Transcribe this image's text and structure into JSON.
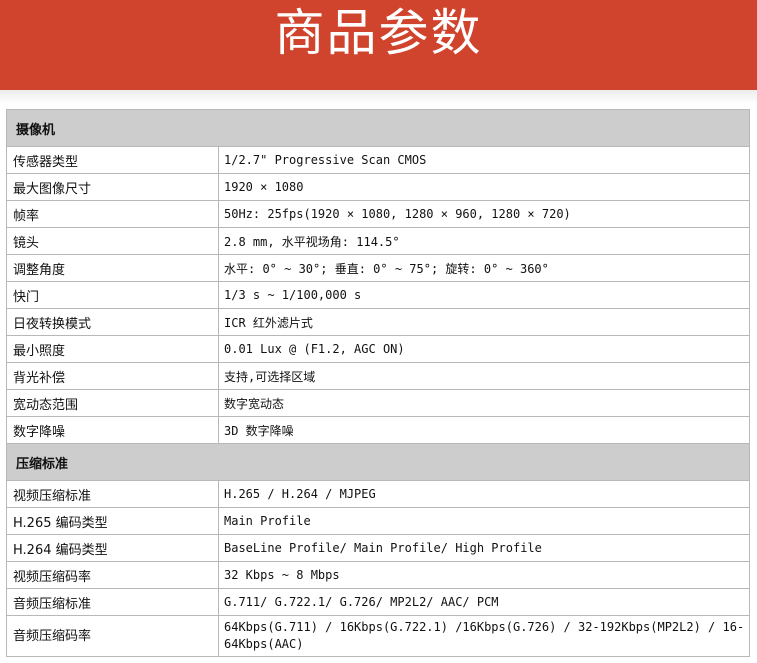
{
  "banner": {
    "title": "商品参数"
  },
  "sections": [
    {
      "title": "摄像机",
      "rows": [
        {
          "label": "传感器类型",
          "value": "1/2.7\" Progressive Scan CMOS"
        },
        {
          "label": "最大图像尺寸",
          "value": "1920 × 1080"
        },
        {
          "label": "帧率",
          "value": "50Hz: 25fps(1920 × 1080, 1280 × 960, 1280 × 720)"
        },
        {
          "label": "镜头",
          "value": "2.8 mm, 水平视场角: 114.5°"
        },
        {
          "label": "调整角度",
          "value": "水平: 0° ~ 30°; 垂直: 0° ~ 75°; 旋转: 0° ~ 360°"
        },
        {
          "label": "快门",
          "value": "1/3 s ~ 1/100,000 s"
        },
        {
          "label": "日夜转换模式",
          "value": "ICR 红外滤片式"
        },
        {
          "label": "最小照度",
          "value": "0.01 Lux @ (F1.2, AGC ON)"
        },
        {
          "label": "背光补偿",
          "value": "支持,可选择区域"
        },
        {
          "label": "宽动态范围",
          "value": "数字宽动态"
        },
        {
          "label": "数字降噪",
          "value": "3D 数字降噪"
        }
      ]
    },
    {
      "title": "压缩标准",
      "rows": [
        {
          "label": "视频压缩标准",
          "value": "H.265 / H.264 / MJPEG"
        },
        {
          "label": "H.265 编码类型",
          "value": "Main Profile"
        },
        {
          "label": "H.264 编码类型",
          "value": "BaseLine Profile/ Main Profile/ High Profile"
        },
        {
          "label": "视频压缩码率",
          "value": "32 Kbps ~ 8 Mbps"
        },
        {
          "label": "音频压缩标准",
          "value": "G.711/ G.722.1/ G.726/ MP2L2/ AAC/ PCM"
        },
        {
          "label": "音频压缩码率",
          "value": "64Kbps(G.711) / 16Kbps(G.722.1) /16Kbps(G.726) / 32-192Kbps(MP2L2) / 16-64Kbps(AAC)"
        }
      ]
    }
  ]
}
